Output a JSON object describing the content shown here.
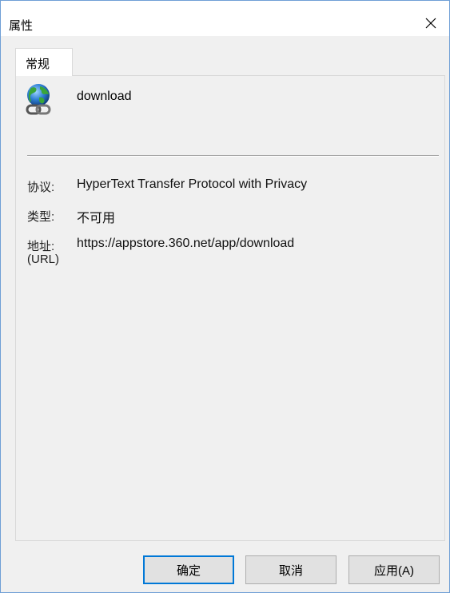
{
  "window": {
    "title": "属性",
    "close_icon": "close-icon"
  },
  "tabs": [
    {
      "label": "常规",
      "selected": true
    }
  ],
  "general": {
    "icon": "internet-shortcut-globe-icon",
    "name": "download",
    "protocol_label": "协议:",
    "protocol_value": "HyperText Transfer Protocol with Privacy",
    "type_label": "类型:",
    "type_value": "不可用",
    "address_label_line1": "地址:",
    "address_label_line2": "(URL)",
    "address_value": "https://appstore.360.net/app/download"
  },
  "buttons": {
    "ok": "确定",
    "cancel": "取消",
    "apply": "应用(A)"
  },
  "colors": {
    "window_border": "#6f9fd6",
    "focus_border": "#0078d7",
    "dialog_bg": "#f0f0f0"
  }
}
